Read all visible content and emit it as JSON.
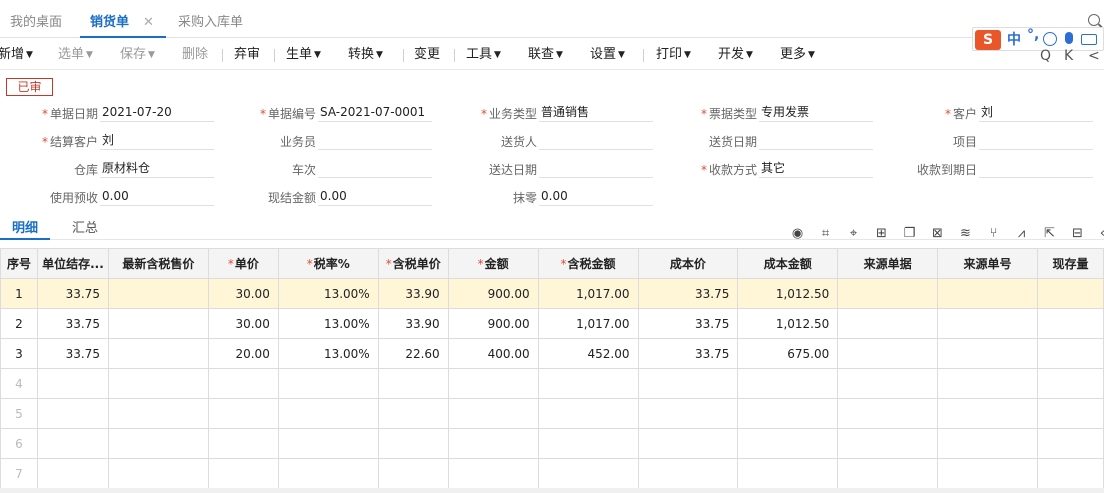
{
  "tabs": [
    {
      "label": "我的桌面"
    },
    {
      "label": "销货单",
      "close": "✕"
    },
    {
      "label": "采购入库单"
    }
  ],
  "ime": {
    "logo": "S",
    "lang": "中",
    "punct": "°,"
  },
  "toolbar": {
    "add": "新增",
    "select": "选单",
    "save": "保存",
    "delete": "删除",
    "abandon": "弃审",
    "generate": "生单",
    "convert": "转换",
    "change": "变更",
    "tools": "工具",
    "link": "联查",
    "settings": "设置",
    "print": "打印",
    "develop": "开发",
    "more": "更多",
    "nav_icons": [
      "Q",
      "K",
      "<"
    ]
  },
  "status": "已审",
  "form": {
    "doc_date": {
      "label": "单据日期",
      "value": "2021-07-20"
    },
    "doc_no": {
      "label": "单据编号",
      "value": "SA-2021-07-0001"
    },
    "biz_type": {
      "label": "业务类型",
      "value": "普通销售"
    },
    "invoice_type": {
      "label": "票据类型",
      "value": "专用发票"
    },
    "customer": {
      "label": "客户",
      "value": "刘"
    },
    "settle_customer": {
      "label": "结算客户",
      "value": "刘"
    },
    "salesman": {
      "label": "业务员",
      "value": ""
    },
    "deliverer": {
      "label": "送货人",
      "value": ""
    },
    "delivery_date": {
      "label": "送货日期",
      "value": ""
    },
    "project": {
      "label": "项目",
      "value": ""
    },
    "warehouse": {
      "label": "仓库",
      "value": "原材料仓"
    },
    "train_no": {
      "label": "车次",
      "value": ""
    },
    "arrival_date": {
      "label": "送达日期",
      "value": ""
    },
    "payment_method": {
      "label": "收款方式",
      "value": "其它"
    },
    "due_date": {
      "label": "收款到期日",
      "value": ""
    },
    "prepaid": {
      "label": "使用预收",
      "value": "0.00"
    },
    "cash_settled": {
      "label": "现结金额",
      "value": "0.00"
    },
    "rounding": {
      "label": "抹零",
      "value": "0.00"
    }
  },
  "detail_tabs": {
    "detail": "明细",
    "summary": "汇总"
  },
  "grid": {
    "headers": [
      "序号",
      "单位结存...",
      "最新含税售价",
      "单价",
      "税率%",
      "含税单价",
      "金额",
      "含税金额",
      "成本价",
      "成本金额",
      "来源单据",
      "来源单号",
      "现存量"
    ],
    "rows": [
      [
        "1",
        "33.75",
        "",
        "30.00",
        "13.00%",
        "33.90",
        "900.00",
        "1,017.00",
        "33.75",
        "1,012.50",
        "",
        "",
        ""
      ],
      [
        "2",
        "33.75",
        "",
        "30.00",
        "13.00%",
        "33.90",
        "900.00",
        "1,017.00",
        "33.75",
        "1,012.50",
        "",
        "",
        ""
      ],
      [
        "3",
        "33.75",
        "",
        "20.00",
        "13.00%",
        "22.60",
        "400.00",
        "452.00",
        "33.75",
        "675.00",
        "",
        "",
        ""
      ],
      [
        "4",
        "",
        "",
        "",
        "",
        "",
        "",
        "",
        "",
        "",
        "",
        "",
        ""
      ],
      [
        "5",
        "",
        "",
        "",
        "",
        "",
        "",
        "",
        "",
        "",
        "",
        "",
        ""
      ],
      [
        "6",
        "",
        "",
        "",
        "",
        "",
        "",
        "",
        "",
        "",
        "",
        "",
        ""
      ],
      [
        "7",
        "",
        "",
        "",
        "",
        "",
        "",
        "",
        "",
        "",
        "",
        "",
        ""
      ]
    ]
  },
  "colors": {
    "accent": "#1a6fc4",
    "required": "#e04a3a",
    "selected_row": "#fff6d8",
    "status": "#c0392b"
  }
}
